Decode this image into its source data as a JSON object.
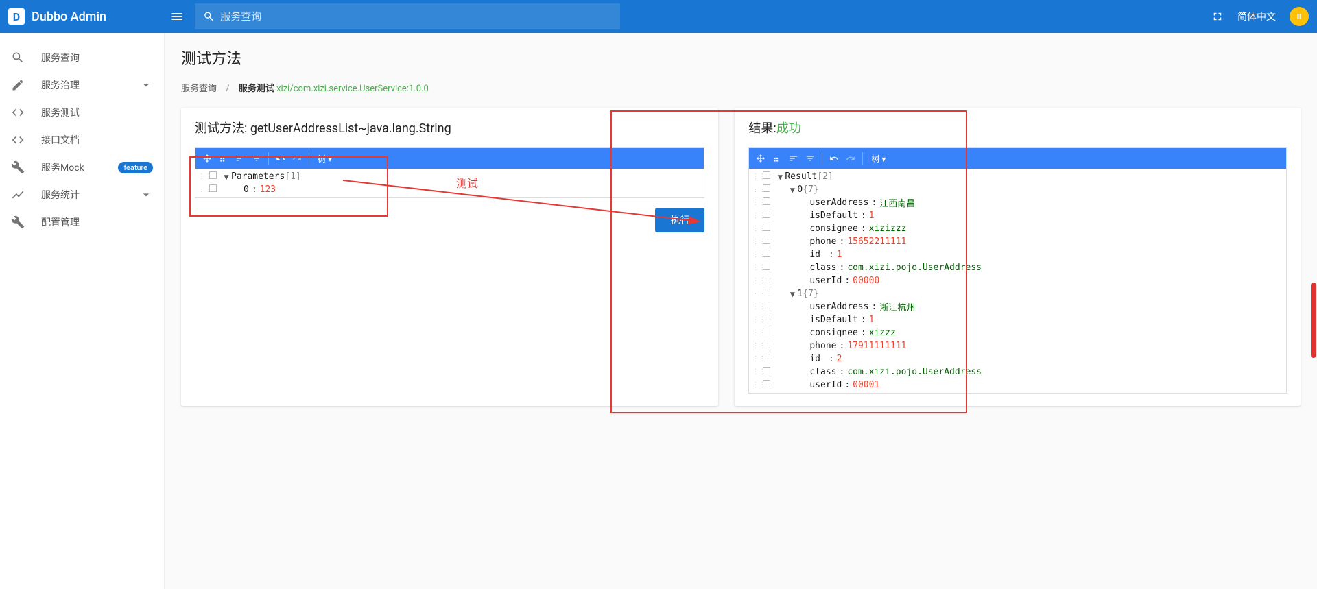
{
  "header": {
    "brand": "Dubbo Admin",
    "search_placeholder": "服务查询",
    "language": "简体中文"
  },
  "sidebar": {
    "items": [
      {
        "icon": "search",
        "label": "服务查询"
      },
      {
        "icon": "edit",
        "label": "服务治理",
        "expand": true
      },
      {
        "icon": "code",
        "label": "服务测试"
      },
      {
        "icon": "code",
        "label": "接口文档"
      },
      {
        "icon": "wrench",
        "label": "服务Mock",
        "badge": "feature"
      },
      {
        "icon": "chart",
        "label": "服务统计",
        "expand": true
      },
      {
        "icon": "wrench",
        "label": "配置管理"
      }
    ]
  },
  "page": {
    "title": "测试方法",
    "breadcrumb": {
      "root": "服务查询",
      "current": "服务测试",
      "service": "xizi/com.xizi.service.UserService:1.0.0"
    }
  },
  "left_panel": {
    "title": "测试方法: getUserAddressList~java.lang.String",
    "mode_label": "树",
    "tree": {
      "root": "Parameters",
      "count": "[1]",
      "items": [
        {
          "key": "0",
          "value": "123"
        }
      ]
    },
    "exec": "执行"
  },
  "right_panel": {
    "title_prefix": "结果:",
    "title_status": "成功",
    "mode_label": "树",
    "tree": {
      "root": "Result",
      "count": "[2]",
      "items": [
        {
          "key": "0",
          "count": "{7}",
          "children": [
            {
              "key": "userAddress",
              "value": "江西南昌",
              "type": "str"
            },
            {
              "key": "isDefault",
              "value": "1",
              "type": "num"
            },
            {
              "key": "consignee",
              "value": "xizizzz",
              "type": "str"
            },
            {
              "key": "phone",
              "value": "15652211111",
              "type": "num"
            },
            {
              "key": "id",
              "value": "1",
              "type": "num",
              "pad": true
            },
            {
              "key": "class",
              "value": "com.xizi.pojo.UserAddress",
              "type": "str"
            },
            {
              "key": "userId",
              "value": "00000",
              "type": "num"
            }
          ]
        },
        {
          "key": "1",
          "count": "{7}",
          "children": [
            {
              "key": "userAddress",
              "value": "浙江杭州",
              "type": "str"
            },
            {
              "key": "isDefault",
              "value": "1",
              "type": "num"
            },
            {
              "key": "consignee",
              "value": "xizzz",
              "type": "str"
            },
            {
              "key": "phone",
              "value": "17911111111",
              "type": "num"
            },
            {
              "key": "id",
              "value": "2",
              "type": "num",
              "pad": true
            },
            {
              "key": "class",
              "value": "com.xizi.pojo.UserAddress",
              "type": "str"
            },
            {
              "key": "userId",
              "value": "00001",
              "type": "num"
            }
          ]
        }
      ]
    }
  },
  "annotation": {
    "label": "测试"
  }
}
